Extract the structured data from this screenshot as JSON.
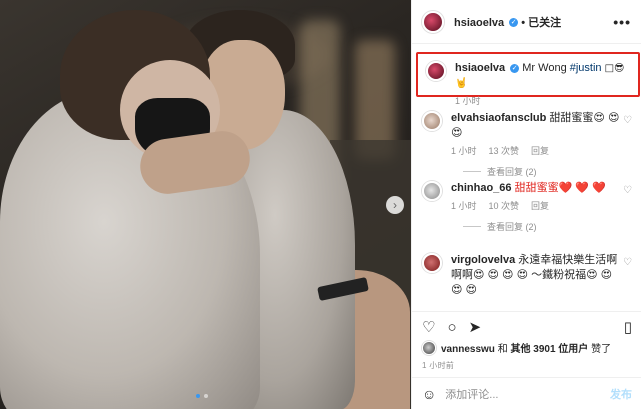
{
  "post_header": {
    "username": "hsiaoelva",
    "verified_mark": "✓",
    "follow_status": "• 已关注",
    "more_icon": "•••"
  },
  "caption": {
    "username": "hsiaoelva",
    "text": "Mr Wong",
    "hashtag": "#justin",
    "emoji": "□😎 🤘",
    "time": "1 小时"
  },
  "comments": [
    {
      "username": "elvahsiaofansclub",
      "text": "甜甜蜜蜜😍 😍 😍",
      "time": "1 小时",
      "likes": "13 次赞",
      "reply": "回复",
      "replies": "查看回复 (2)"
    },
    {
      "username": "chinhao_66",
      "text": "甜甜蜜蜜❤️ ❤️ ❤️",
      "time": "1 小时",
      "likes": "10 次赞",
      "reply": "回复",
      "replies": "查看回复 (2)"
    },
    {
      "username": "virgolovelva",
      "text": "永遠幸福快樂生活啊啊啊😍 😍 😍 😍 〜鐵粉祝福😍 😍 😍 😍",
      "time": "",
      "likes": "",
      "reply": "",
      "replies": ""
    }
  ],
  "likes_line": {
    "user": "vannesswu",
    "and": "和",
    "others": "其他 3901 位用户",
    "suffix": "赞了"
  },
  "timestamp": "1 小时前",
  "add_comment": {
    "placeholder": "添加评论...",
    "post_label": "发布"
  },
  "icons": {
    "like": "♡",
    "comment": "○",
    "share": "➤",
    "save": "▯",
    "next": "›",
    "emoji": "☺"
  }
}
